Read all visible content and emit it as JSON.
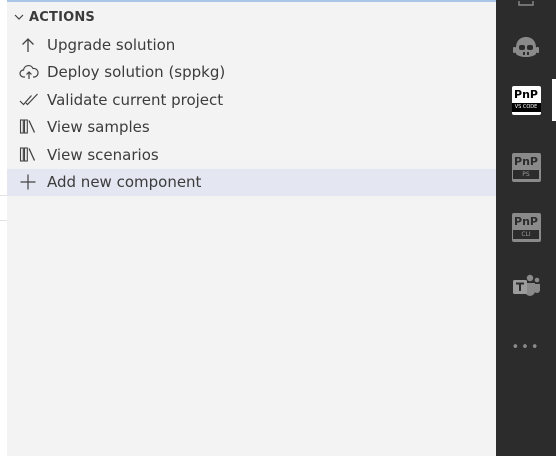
{
  "section": {
    "title": "ACTIONS",
    "expanded": true
  },
  "actions": [
    {
      "label": "Upgrade solution",
      "icon": "arrow-up-icon"
    },
    {
      "label": "Deploy solution (sppkg)",
      "icon": "cloud-upload-icon"
    },
    {
      "label": "Validate current project",
      "icon": "double-check-icon"
    },
    {
      "label": "View samples",
      "icon": "library-icon"
    },
    {
      "label": "View scenarios",
      "icon": "library-icon"
    },
    {
      "label": "Add new component",
      "icon": "plus-icon",
      "selected": true
    }
  ],
  "activity_bar": {
    "items": [
      {
        "name": "copilot-icon"
      },
      {
        "name": "pnp-vscode-icon",
        "title": "PnP",
        "sub": "VS CODE",
        "active": true
      },
      {
        "name": "pnp-powershell-icon",
        "title": "PnP",
        "sub": "PS"
      },
      {
        "name": "pnp-cli-icon",
        "title": "PnP",
        "sub": "CLI"
      },
      {
        "name": "teams-icon"
      },
      {
        "name": "more-icon",
        "label": "•••"
      }
    ]
  },
  "colors": {
    "panel_bg": "#f3f3f3",
    "selected_row": "#e4e6f1",
    "activity_bg": "#2c2c2c",
    "text": "#3c3c3c"
  }
}
